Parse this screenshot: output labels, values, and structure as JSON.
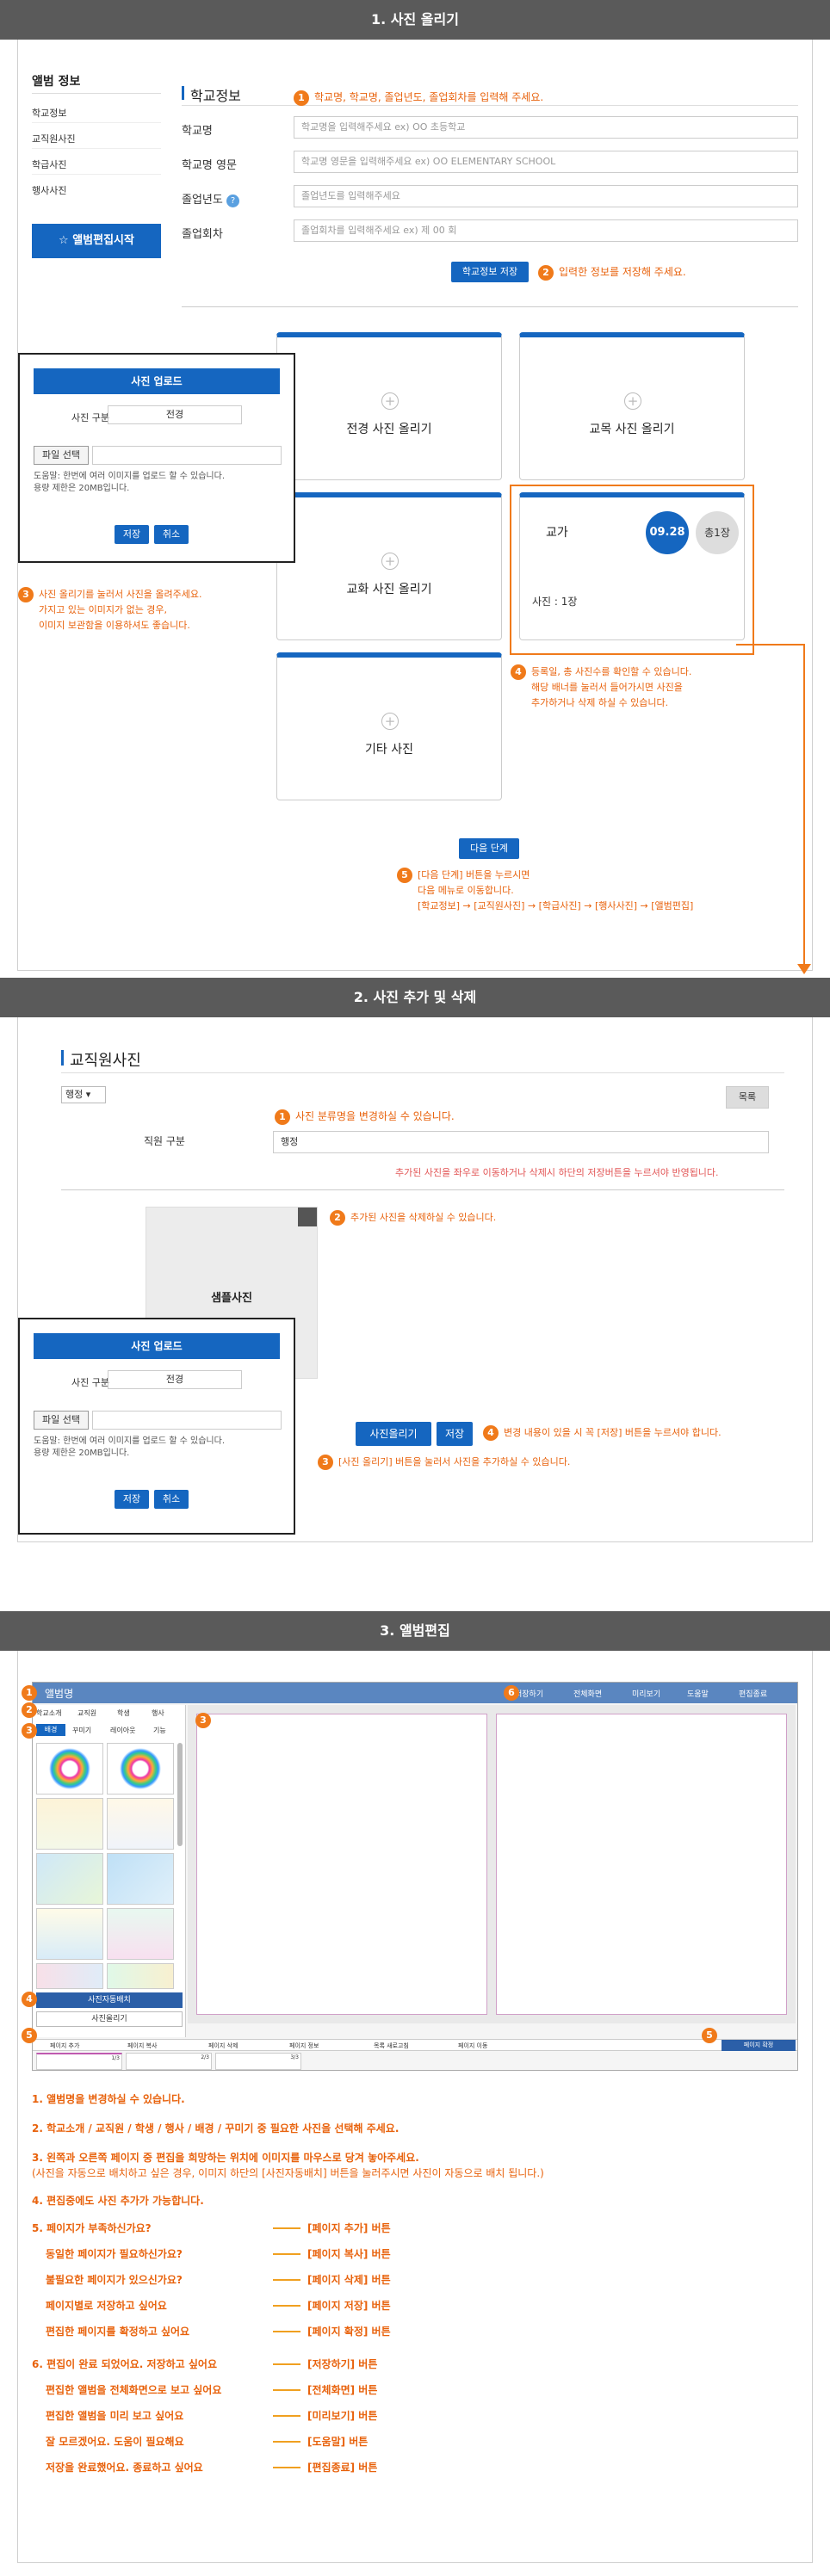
{
  "sec1": {
    "title": "1. 사진 올리기",
    "sidebar": {
      "title": "앨범 정보",
      "items": [
        "학교정보",
        "교직원사진",
        "학급사진",
        "행사사진"
      ],
      "start_button": "앨범편집시작",
      "start_icon": "star-icon"
    },
    "school": {
      "heading": "학교정보",
      "note1": "학교명, 학교명, 졸업년도, 졸업회차를 입력해 주세요.",
      "fields": [
        {
          "label": "학교명",
          "placeholder": "학교명을 입력해주세요 ex) OO 초등학교"
        },
        {
          "label": "학교명 영문",
          "placeholder": "학교명 영문을 입력해주세요 ex) OO ELEMENTARY SCHOOL"
        },
        {
          "label": "졸업년도",
          "placeholder": "졸업년도를 입력해주세요"
        },
        {
          "label": "졸업회차",
          "placeholder": "졸업회차를 입력해주세요 ex) 제 00 회"
        }
      ],
      "save_button": "학교정보 저장",
      "note2": "입력한 정보를 저장해 주세요."
    },
    "cards": [
      {
        "title": "전경 사진 올리기"
      },
      {
        "title": "교목 사진 올리기"
      },
      {
        "title": "교화 사진 올리기"
      },
      {
        "title": "기타 사진"
      }
    ],
    "anthem": {
      "title": "교가",
      "date": "09.28",
      "total": "총1장",
      "count": "사진 : 1장"
    },
    "popup": {
      "title": "사진 업로드",
      "type_label": "사진 구분",
      "type_value": "전경",
      "file_button": "파일 선택",
      "help1": "도움말: 한번에 여러 이미지를 업로드 할 수 있습니다.",
      "help2": "용량 제한은 20MB입니다.",
      "save": "저장",
      "cancel": "취소"
    },
    "note3": [
      "사진 올리기를 눌러서 사진을 올려주세요.",
      "가지고 있는 이미지가 없는 경우,",
      "이미지 보관함을 이용하셔도 좋습니다."
    ],
    "note4": [
      "등록일, 총 사진수를 확인할 수 있습니다.",
      "해당 배너를 눌러서 들어가시면 사진을",
      "추가하거나 삭제 하실 수 있습니다."
    ],
    "next_button": "다음 단계",
    "note5": [
      "[다음 단계] 버튼을 누르시면",
      "다음 메뉴로 이동합니다.",
      "[학교정보] → [교직원사진] → [학급사진] → [행사사진] → [앨범편집]"
    ]
  },
  "sec2": {
    "title": "2. 사진 추가 및 삭제",
    "heading": "교직원사진",
    "select_value": "행정",
    "list_button": "목록",
    "note1": "사진 분류명을 변경하실 수 있습니다.",
    "staff_label": "직원 구분",
    "staff_value": "행정",
    "red_note": "추가된 사진을 좌우로 이동하거나 삭제시 하단의 저장버튼을 누르셔야 반영됩니다.",
    "note2": "추가된 사진을 삭제하실 수 있습니다.",
    "sample": "샘플사진",
    "popup": {
      "title": "사진 업로드",
      "type_label": "사진 구분",
      "type_value": "전경",
      "file_button": "파일 선택",
      "help1": "도움말: 한번에 여러 이미지를 업로드 할 수 있습니다.",
      "help2": "용량 제한은 20MB입니다.",
      "save": "저장",
      "cancel": "취소"
    },
    "upload_button": "사진올리기",
    "save_button": "저장",
    "note4": "변경 내용이 있을 시 꼭 [저장] 버튼을 누르셔야 합니다.",
    "note3": "[사진 올리기] 버튼을 눌러서 사진을 추가하실 수 있습니다."
  },
  "sec3": {
    "title": "3. 앨범편집",
    "editor": {
      "album_name": "앨범명",
      "top_buttons": [
        "저장하기",
        "전체화면",
        "미리보기",
        "도움말",
        "편집종료"
      ],
      "cat_tabs": [
        "학교소개",
        "교직원",
        "학생",
        "행사"
      ],
      "sub_tabs": [
        "배경",
        "꾸미기",
        "레이아웃",
        "기능"
      ],
      "auto_button": "사진자동배치",
      "upload_button": "사진올리기",
      "bottom_buttons": [
        "페이지 추가",
        "페이지 복사",
        "페이지 삭제",
        "페이지 정보",
        "목록 새로고침",
        "페이지 이동"
      ],
      "page_save": "페이지 확정",
      "pages": [
        "1/3",
        "2/3",
        "3/3"
      ],
      "markers": [
        "1",
        "2",
        "3",
        "3",
        "4",
        "5",
        "5",
        "6"
      ]
    },
    "guide": [
      "1. 앨범명을 변경하실 수 있습니다.",
      "2. 학교소개 / 교직원 / 학생 / 행사 / 배경 / 꾸미기 중 필요한 사진을 선택해 주세요.",
      "3. 왼쪽과 오른쪽 페이지 중 편집을 희망하는 위치에 이미지를 마우스로 당겨 놓아주세요.",
      "(사진을 자동으로 배치하고 싶은 경우, 이미지 하단의 [사진자동배치] 버튼을 눌러주시면 사진이 자동으로 배치 됩니다.)",
      "4. 편집중에도 사진 추가가 가능합니다."
    ],
    "guide_rows": [
      {
        "q": "5. 페이지가 부족하신가요?",
        "a": "[페이지 추가] 버튼"
      },
      {
        "q": "동일한 페이지가 필요하신가요?",
        "a": "[페이지 복사] 버튼"
      },
      {
        "q": "불필요한 페이지가 있으신가요?",
        "a": "[페이지 삭제] 버튼"
      },
      {
        "q": "페이지별로 저장하고 싶어요",
        "a": "[페이지 저장] 버튼"
      },
      {
        "q": "편집한 페이지를 확정하고 싶어요",
        "a": "[페이지 확정] 버튼"
      },
      {
        "q": "6. 편집이 완료 되었어요. 저장하고 싶어요",
        "a": "[저장하기] 버튼"
      },
      {
        "q": "편집한 앨범을 전체화면으로 보고 싶어요",
        "a": "[전체화면] 버튼"
      },
      {
        "q": "편집한 앨범을 미리 보고 싶어요",
        "a": "[미리보기] 버튼"
      },
      {
        "q": "잘 모르겠어요. 도움이 필요해요",
        "a": "[도움말] 버튼"
      },
      {
        "q": "저장을 완료했어요. 종료하고 싶어요",
        "a": "[편집종료] 버튼"
      }
    ]
  },
  "colors": {
    "accent": "#1566c0",
    "orange": "#f07a1a",
    "band": "#5a5a5a"
  }
}
